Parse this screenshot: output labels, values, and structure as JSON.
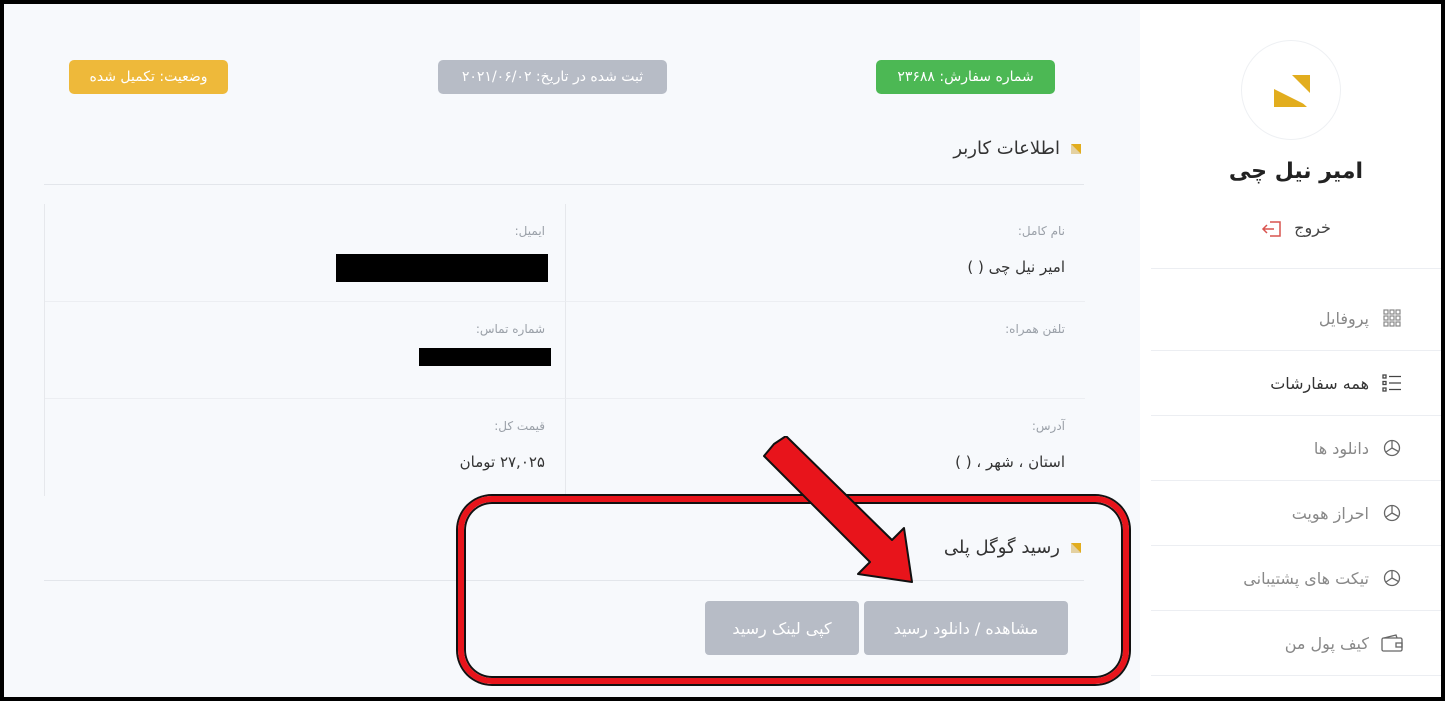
{
  "sidebar": {
    "user_name": "امیر نیل چی",
    "logout_label": "خروج",
    "items": [
      {
        "label": "پروفایل",
        "icon": "grid-icon"
      },
      {
        "label": "همه سفارشات",
        "icon": "list-icon"
      },
      {
        "label": "دانلود ها",
        "icon": "pie-chart-icon"
      },
      {
        "label": "احراز هویت",
        "icon": "pie-chart-icon"
      },
      {
        "label": "تیکت های پشتیبانی",
        "icon": "pie-chart-icon"
      },
      {
        "label": "کیف پول من",
        "icon": "wallet-icon"
      }
    ]
  },
  "order": {
    "number_badge": "شماره سفارش: ۲۳۶۸۸",
    "date_badge": "ثبت شده در تاریخ: ۲۰۲۱/۰۶/۰۲",
    "status_badge": "وضعیت: تکمیل شده"
  },
  "user_info": {
    "title": "اطلاعات کاربر",
    "full_name_label": "نام کامل:",
    "full_name_value": "امیر نیل چی ( )",
    "email_label": "ایمیل:",
    "mobile_label": "تلفن همراه:",
    "contact_label": "شماره تماس:",
    "address_label": "آدرس:",
    "address_value": "استان ، شهر ، ( )",
    "total_label": "قیمت کل:",
    "total_value": "۲۷,۰۲۵  تومان"
  },
  "receipt": {
    "title": "رسید گوگل پلی",
    "view_button": "مشاهده / دانلود رسید",
    "copy_button": "کپی لینک رسید"
  },
  "colors": {
    "accent": "#e2ad1e",
    "success": "#4cb854",
    "neutral": "#b7bcc6",
    "warning": "#eeb93a",
    "annotation": "#e8141b"
  }
}
